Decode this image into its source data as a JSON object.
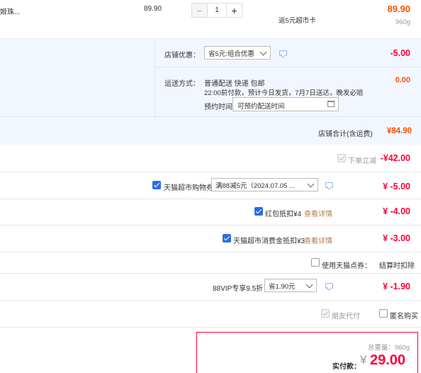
{
  "item": {
    "name_fragment": "姬珠...",
    "unit_price": "89.90",
    "quantity": "1",
    "rebate_note": "返5元超市卡",
    "subtotal": "89.90",
    "weight": "960g"
  },
  "shop": {
    "discount_label": "店铺优惠：",
    "discount_select": "省5元:组合优惠",
    "discount_amount": "-5.00",
    "shipping_label": "运送方式：",
    "shipping_method": "普通配送 快递 包邮",
    "shipping_note": "22:00前付款，预计今日发货，7月7日送达，晚发必赔",
    "reserve_label": "预约时间",
    "reserve_placeholder": "可预约配送时间",
    "shipping_amount": "0.00",
    "total_label": "店铺合计(含运费)",
    "total_amount": "¥84.90"
  },
  "discounts": {
    "instant_label": "下单立减",
    "instant_amount": "-¥42.00",
    "coupon_label": "天猫超市购物券",
    "coupon_select": "满88减5元（2024.07.05 ...",
    "coupon_amount": "¥ -5.00",
    "redpacket_label": "红包抵扣¥4",
    "redpacket_link": "查看详情",
    "redpacket_amount": "¥ -4.00",
    "consume_label": "天猫超市消费金抵扣¥3",
    "consume_link": "查看详情",
    "consume_amount": "¥ -3.00",
    "points_label": "使用天猫点券：",
    "points_note": "结算时扣除",
    "vip_label": "88VIP专享9.5折",
    "vip_select": "省1.90元",
    "vip_amount": "¥ -1.90",
    "friend_pay_label": "朋友代付",
    "anonymous_label": "匿名购买"
  },
  "summary": {
    "weight_label": "总重量：",
    "weight_value": "960g",
    "pay_label": "实付款：",
    "currency": "¥",
    "pay_amount": "29.00"
  },
  "colors": {
    "accent_red": "#ff0036",
    "accent_orange": "#ff5000",
    "band_blue": "#f2f7ff",
    "checkbox_blue": "#2b6de5"
  }
}
